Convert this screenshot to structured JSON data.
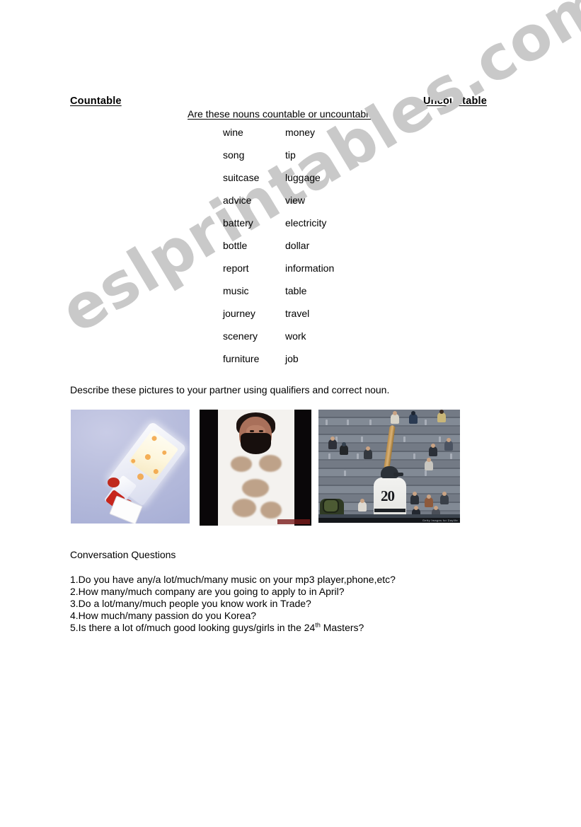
{
  "document": {
    "headings": {
      "countable": "Countable",
      "uncountable": "Uncountable"
    },
    "prompt": "Are these nouns countable or uncountable?",
    "word_list": [
      {
        "a": "wine",
        "b": "money"
      },
      {
        "a": "song",
        "b": "tip"
      },
      {
        "a": "suitcase",
        "b": "luggage"
      },
      {
        "a": "advice",
        "b": "view"
      },
      {
        "a": "battery",
        "b": "electricity"
      },
      {
        "a": "bottle",
        "b": "dollar"
      },
      {
        "a": "report",
        "b": "information"
      },
      {
        "a": "music",
        "b": "table"
      },
      {
        "a": "journey",
        "b": "travel"
      },
      {
        "a": "scenery",
        "b": "work"
      },
      {
        "a": "furniture",
        "b": "job"
      }
    ],
    "describe_instruction": "Describe these pictures to your partner using qualifiers and correct noun.",
    "pictures": [
      {
        "name": "bottle-photo",
        "alt": "Tilted glass sauce bottle with white and orange contents on a lavender background"
      },
      {
        "name": "hairy-man-photo",
        "alt": "Bearded man with very hairy chest and arms against a dark background"
      },
      {
        "name": "baseball-photo",
        "alt": "Baseball batter wearing number 20 in front of a sparsely filled stadium crowd"
      }
    ],
    "baseball_jersey_number": "20",
    "baseball_footer_credit": "Getty Images for Daylife",
    "conversation": {
      "title": "Conversation Questions",
      "questions": [
        "1.Do you have any/a lot/much/many music on your mp3 player,phone,etc?",
        "2.How many/much company are you going to apply to in April?",
        "3.Do a lot/many/much people you know work in Trade?",
        "4.How much/many passion do you Korea?",
        "5.Is there a lot of/much good looking guys/girls in the 24"
      ],
      "question5_superscript": "th",
      "question5_tail": " Masters?"
    },
    "watermark": "eslprintables.com",
    "colors": {
      "page_background": "#ffffff",
      "text": "#000000",
      "watermark": "#c9c9c9",
      "bottle_photo_background": "#b4bada",
      "hairy_photo_background": "#0a0709",
      "baseball_photo_background": "#5d646e"
    }
  }
}
